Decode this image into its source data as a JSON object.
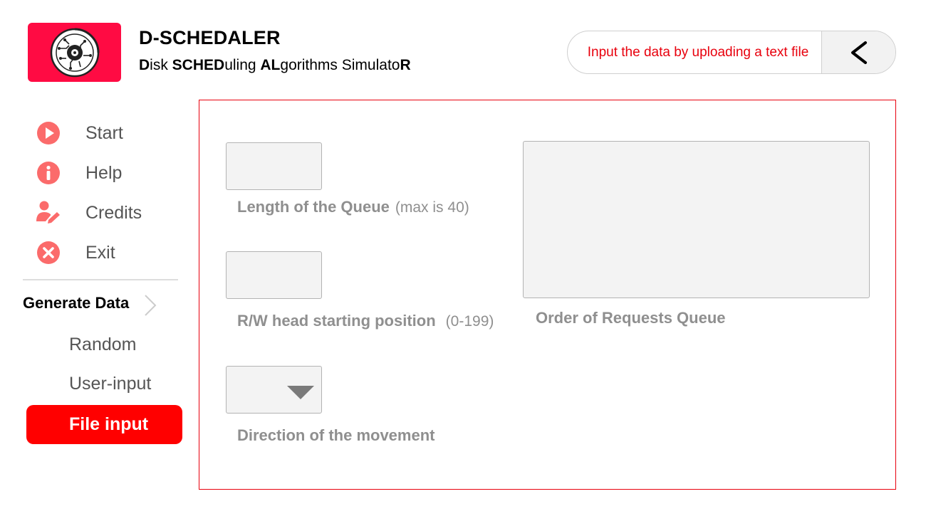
{
  "header": {
    "title": "D-SCHEDALER",
    "subtitle_parts": [
      {
        "text": "D",
        "bold": true
      },
      {
        "text": "isk ",
        "bold": false
      },
      {
        "text": "SCHED",
        "bold": true
      },
      {
        "text": "uling ",
        "bold": false
      },
      {
        "text": "AL",
        "bold": true
      },
      {
        "text": "gorithms Simulato",
        "bold": false
      },
      {
        "text": "R",
        "bold": true
      }
    ],
    "hint": "Input the data by uploading a text file",
    "back_icon": "chevron-left-icon"
  },
  "sidebar": {
    "items": [
      {
        "label": "Start",
        "icon": "play-icon"
      },
      {
        "label": "Help",
        "icon": "info-icon"
      },
      {
        "label": "Credits",
        "icon": "user-pen-icon"
      },
      {
        "label": "Exit",
        "icon": "close-circle-icon"
      }
    ],
    "generate": {
      "title": "Generate Data",
      "options": [
        "Random",
        "User-input",
        "File input"
      ],
      "active": "File input"
    }
  },
  "form": {
    "queue_length": {
      "label": "Length of the Queue",
      "hint": "(max is 40)",
      "value": ""
    },
    "head_position": {
      "label": "R/W head starting position",
      "hint": "(0-199)",
      "value": ""
    },
    "direction": {
      "label": "Direction of the movement",
      "value": ""
    },
    "requests_queue": {
      "label": "Order of Requests Queue",
      "value": ""
    }
  },
  "colors": {
    "accent": "#ff0000",
    "logo_bg": "#ff0b43",
    "icon": "#fb6b6b",
    "hint_text": "#e8000d"
  }
}
